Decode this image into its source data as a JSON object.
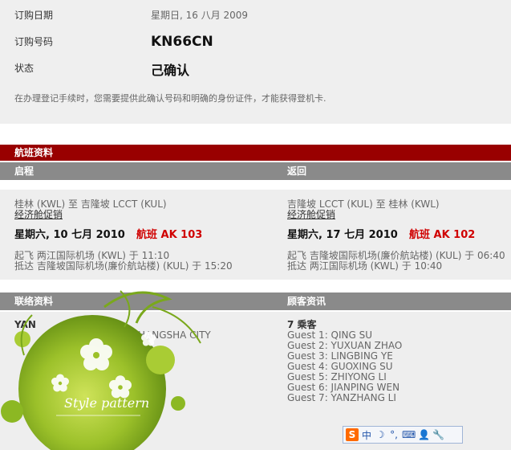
{
  "booking": {
    "date_label": "订购日期",
    "date_value": "星期日, 16 八月 2009",
    "number_label": "订购号码",
    "number_value": "KN66CN",
    "status_label": "状态",
    "status_value": "己确认",
    "notice": "在办理登记手续时，您需要提供此确认号码和明确的身份证件，才能获得登机卡."
  },
  "flight_section": {
    "title": "航班资料",
    "outbound": {
      "header": "启程",
      "route": "桂林 (KWL) 至 吉隆坡 LCCT (KUL)",
      "fare": "经济舱促销",
      "date": "星期六, 10 七月 2010",
      "flight": "航班 AK 103",
      "depart": "起飞 两江国际机场 (KWL) 于 11:10",
      "arrive": "抵达 吉隆坡国际机场(廉价航站楼) (KUL) 于 15:20"
    },
    "return": {
      "header": "返回",
      "route": "吉隆坡 LCCT (KUL) 至 桂林 (KWL)",
      "fare": "经济舱促销",
      "date": "星期六, 17 七月 2010",
      "flight": "航班 AK 102",
      "depart": "起飞 吉隆坡国际机场(廉价航站楼) (KUL) 于 06:40",
      "arrive": "抵达 两江国际机场 (KWL) 于 10:40"
    }
  },
  "contact": {
    "header": "联络资料",
    "name_partial": "YAN",
    "address_partial": "HANGSHA CITY"
  },
  "guests": {
    "header": "顾客资讯",
    "count": "7 乘客",
    "list": [
      "Guest 1: QING SU",
      "Guest 2: YUXUAN ZHAO",
      "Guest 3: LINGBING YE",
      "Guest 4: GUOXING SU",
      "Guest 5: ZHIYONG LI",
      "Guest 6: JIANPING WEN",
      "Guest 7: YANZHANG LI"
    ]
  },
  "decoration": {
    "text": "Style pattern"
  },
  "ime_toolbar": {
    "mode": "中",
    "moon": "☽",
    "punct": "°,",
    "kbd": "⌨",
    "user": "👤",
    "tool": "🔧"
  },
  "colors": {
    "red_bar": "#990000",
    "gray_bar": "#8a8a8a",
    "flight_red": "#d00000",
    "panel": "#eeeeee"
  }
}
